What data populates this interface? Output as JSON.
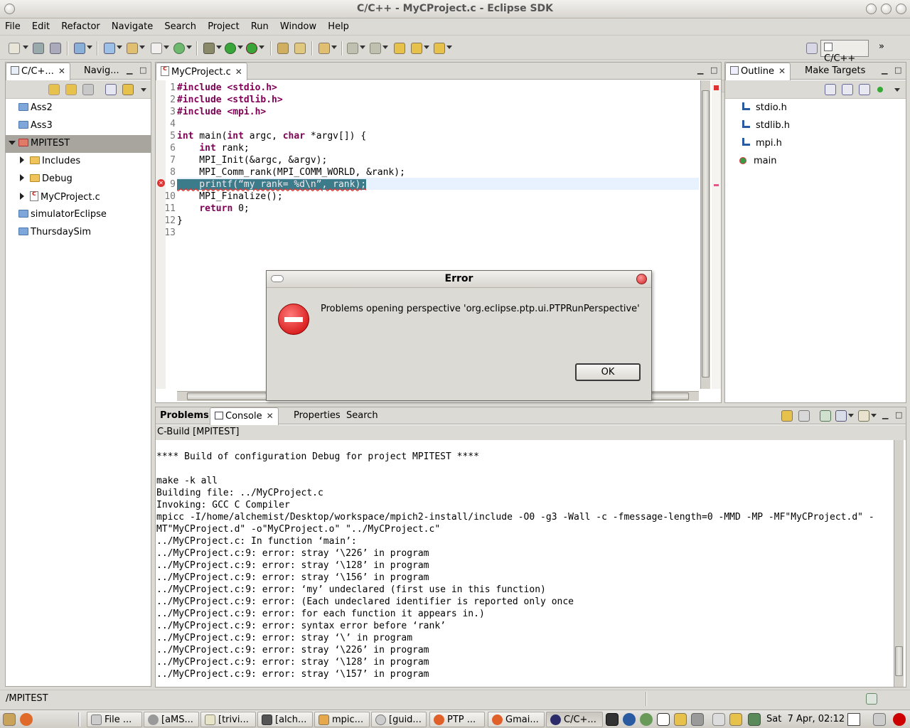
{
  "window": {
    "title": "C/C++ - MyCProject.c - Eclipse SDK"
  },
  "menu": [
    "File",
    "Edit",
    "Refactor",
    "Navigate",
    "Search",
    "Project",
    "Run",
    "Window",
    "Help"
  ],
  "perspective": {
    "label": "C/C++"
  },
  "left_panel": {
    "tabs": [
      {
        "label": "C/C+..."
      },
      {
        "label": "Navig..."
      }
    ],
    "tree": [
      {
        "label": "Ass2"
      },
      {
        "label": "Ass3"
      },
      {
        "label": "MPITEST"
      },
      {
        "label": "Includes"
      },
      {
        "label": "Debug"
      },
      {
        "label": "MyCProject.c"
      },
      {
        "label": "simulatorEclipse"
      },
      {
        "label": "ThursdaySim"
      }
    ]
  },
  "editor": {
    "tab": "MyCProject.c",
    "line_numbers": [
      "1",
      "2",
      "3",
      "4",
      "5",
      "6",
      "7",
      "8",
      "9",
      "10",
      "11",
      "12",
      "13"
    ],
    "lines": [
      [
        "#include <stdio.h>"
      ],
      [
        "#include <stdlib.h>"
      ],
      [
        "#include <mpi.h>"
      ],
      [
        ""
      ],
      [
        "int",
        " main(",
        "int",
        " argc, ",
        "char",
        " *argv[]) {"
      ],
      [
        "    ",
        "int",
        " rank;"
      ],
      [
        "    MPI_Init(&argc, &argv);"
      ],
      [
        "    MPI_Comm_rank(MPI_COMM_WORLD, &rank);"
      ],
      [
        "    printf(“my rank= %d\\n”, rank);"
      ],
      [
        "    MPI_Finalize();"
      ],
      [
        "    ",
        "return",
        " 0;"
      ],
      [
        "}"
      ],
      [
        ""
      ]
    ]
  },
  "outline": {
    "tabs": [
      {
        "label": "Outline"
      },
      {
        "label": "Make Targets"
      }
    ],
    "items": [
      {
        "label": "stdio.h"
      },
      {
        "label": "stdlib.h"
      },
      {
        "label": "mpi.h"
      },
      {
        "label": "main"
      }
    ]
  },
  "dialog": {
    "title": "Error",
    "message": "Problems opening perspective 'org.eclipse.ptp.ui.PTPRunPerspective'",
    "ok": "OK"
  },
  "bottom": {
    "tabs": [
      {
        "label": "Problems"
      },
      {
        "label": "Console"
      },
      {
        "label": "Properties"
      },
      {
        "label": "Search"
      }
    ],
    "console_title": "C-Build [MPITEST]",
    "console_lines": [
      "",
      "**** Build of configuration Debug for project MPITEST ****",
      "",
      "make -k all",
      "Building file: ../MyCProject.c",
      "Invoking: GCC C Compiler",
      "mpicc -I/home/alchemist/Desktop/workspace/mpich2-install/include -O0 -g3 -Wall -c -fmessage-length=0 -MMD -MP -MF\"MyCProject.d\" -",
      "MT\"MyCProject.d\" -o\"MyCProject.o\" \"../MyCProject.c\"",
      "../MyCProject.c: In function ‘main’:",
      "../MyCProject.c:9: error: stray ‘\\226’ in program",
      "../MyCProject.c:9: error: stray ‘\\128’ in program",
      "../MyCProject.c:9: error: stray ‘\\156’ in program",
      "../MyCProject.c:9: error: ‘my’ undeclared (first use in this function)",
      "../MyCProject.c:9: error: (Each undeclared identifier is reported only once",
      "../MyCProject.c:9: error: for each function it appears in.)",
      "../MyCProject.c:9: error: syntax error before ‘rank’",
      "../MyCProject.c:9: error: stray ‘\\’ in program",
      "../MyCProject.c:9: error: stray ‘\\226’ in program",
      "../MyCProject.c:9: error: stray ‘\\128’ in program",
      "../MyCProject.c:9: error: stray ‘\\157’ in program"
    ]
  },
  "status": {
    "path": "/MPITEST"
  },
  "taskbar": {
    "tasks": [
      {
        "label": "File ..."
      },
      {
        "label": "[aMS..."
      },
      {
        "label": "[trivi..."
      },
      {
        "label": "[alch..."
      },
      {
        "label": "mpic..."
      },
      {
        "label": "[guid..."
      },
      {
        "label": "PTP ..."
      },
      {
        "label": "Gmai..."
      },
      {
        "label": "C/C+..."
      }
    ],
    "clock": "Sat  7 Apr, 02:12"
  }
}
